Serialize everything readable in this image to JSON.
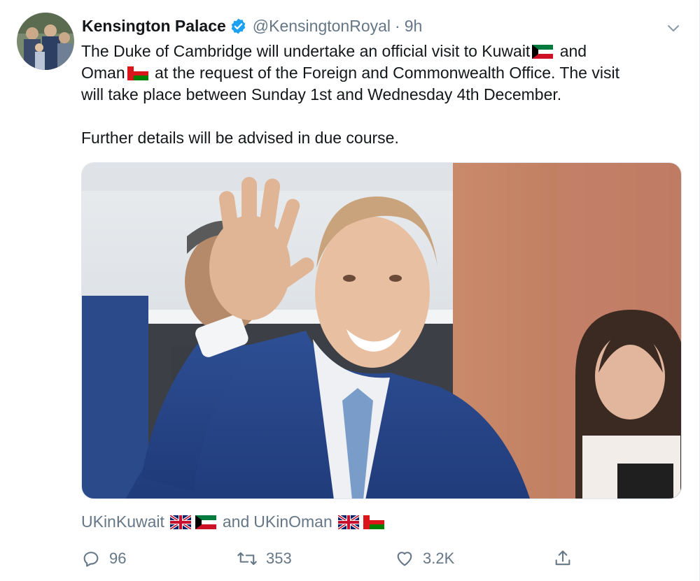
{
  "tweet": {
    "display_name": "Kensington Palace",
    "handle": "@KensingtonRoyal",
    "separator": "·",
    "time": "9h",
    "text": {
      "line1_a": "The Duke of Cambridge will undertake an official visit to Kuwait",
      "line1_b": " and",
      "line2_a": "Oman",
      "line2_b": " at the request of the Foreign and Commonwealth Office. The visit",
      "line3": "will take place between Sunday 1st and Wednesday 4th December.",
      "line4": "Further details will be advised in due course."
    },
    "tags": {
      "tag1": "UKinKuwait",
      "joiner": "and",
      "tag2": "UKinOman"
    },
    "actions": {
      "replies": "96",
      "retweets": "353",
      "likes": "3.2K"
    }
  },
  "icons": {
    "verified": "verified-badge-icon",
    "caret": "chevron-down-icon",
    "reply": "reply-icon",
    "retweet": "retweet-icon",
    "like": "heart-icon",
    "share": "share-icon",
    "flags": [
      "kuwait-flag-icon",
      "oman-flag-icon",
      "uk-flag-icon"
    ]
  },
  "colors": {
    "text": "#14171a",
    "secondary": "#657786",
    "verified": "#1da1f2"
  }
}
